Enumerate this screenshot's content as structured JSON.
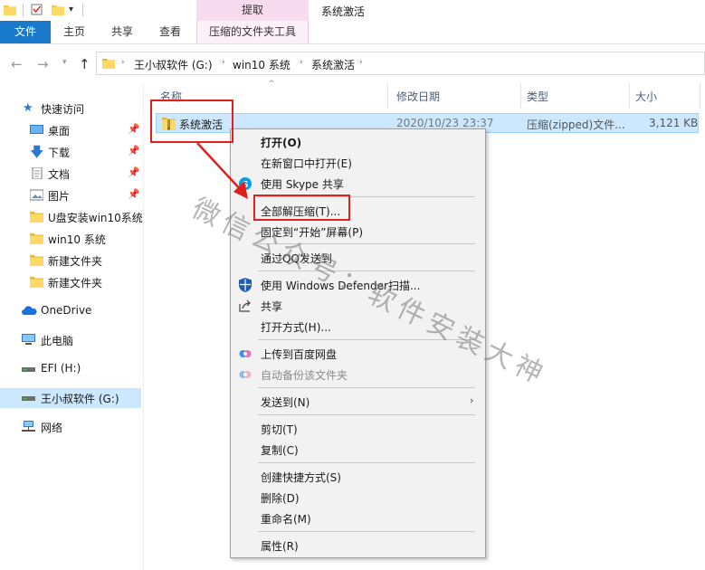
{
  "ribbon": {
    "contextual_header": "提取",
    "window_title": "系统激活",
    "tabs": [
      "文件",
      "主页",
      "共享",
      "查看"
    ],
    "contextual_tab": "压缩的文件夹工具"
  },
  "address": {
    "crumbs": [
      "王小叔软件 (G:)",
      "win10 系统",
      "系统激活"
    ]
  },
  "nav_pane": {
    "quick_access": "快速访问",
    "desktop": "桌面",
    "downloads": "下载",
    "documents": "文档",
    "pictures": "图片",
    "folder1": "U盘安装win10系统",
    "folder2": "win10 系统",
    "folder3": "新建文件夹",
    "folder4": "新建文件夹",
    "onedrive": "OneDrive",
    "this_pc": "此电脑",
    "efi_drive": "EFI (H:)",
    "g_drive": "王小叔软件 (G:)",
    "network": "网络"
  },
  "columns": {
    "name": "名称",
    "modified": "修改日期",
    "type": "类型",
    "size": "大小"
  },
  "file": {
    "name": "系统激活",
    "modified": "2020/10/23 23:37",
    "type": "压缩(zipped)文件...",
    "size": "3,121 KB"
  },
  "context_menu": {
    "open": "打开(O)",
    "open_new_window": "在新窗口中打开(E)",
    "skype_share": "使用 Skype 共享",
    "extract_all": "全部解压缩(T)...",
    "pin_start": "固定到“开始”屏幕(P)",
    "send_qq": "通过QQ发送到",
    "defender_scan": "使用 Windows Defender扫描...",
    "share": "共享",
    "open_with": "打开方式(H)...",
    "upload_baidu": "上传到百度网盘",
    "auto_backup": "自动备份该文件夹",
    "send_to": "发送到(N)",
    "cut": "剪切(T)",
    "copy": "复制(C)",
    "create_shortcut": "创建快捷方式(S)",
    "delete": "删除(D)",
    "rename": "重命名(M)",
    "properties": "属性(R)"
  },
  "watermark": "微信公众号：软件安装大神",
  "colors": {
    "file_tab": "#1979ca",
    "selection": "#cce8ff",
    "highlight_box": "#e0201b",
    "contextual_tab": "#f7dcef"
  }
}
